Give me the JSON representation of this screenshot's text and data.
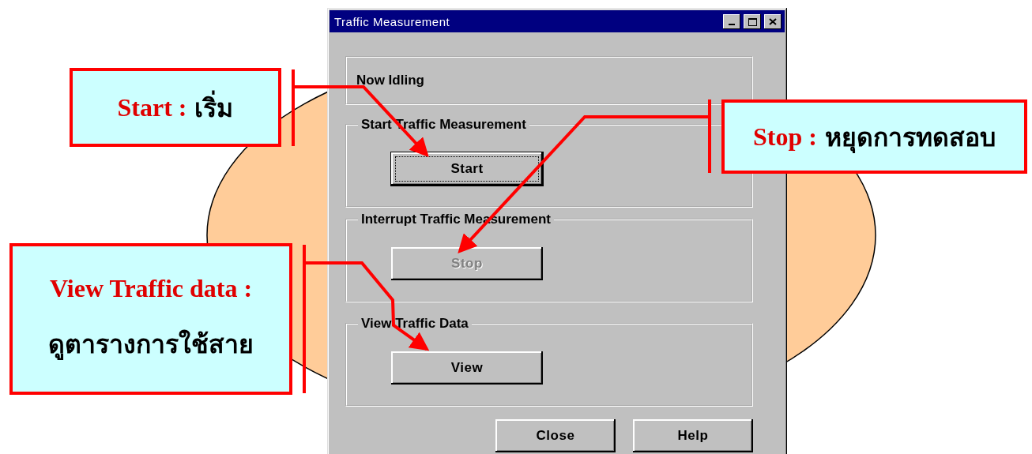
{
  "window": {
    "title": "Traffic Measurement"
  },
  "status": "Now Idling",
  "groups": [
    {
      "title": "Start Traffic Measurement",
      "button": {
        "label": "Start",
        "focused": true,
        "disabled": false
      }
    },
    {
      "title": "Interrupt Traffic Measurement",
      "button": {
        "label": "Stop",
        "focused": false,
        "disabled": true
      }
    },
    {
      "title": "View Traffic Data",
      "button": {
        "label": "View",
        "focused": false,
        "disabled": false
      }
    }
  ],
  "footer_buttons": [
    {
      "label": "Close"
    },
    {
      "label": "Help"
    }
  ],
  "callouts": [
    {
      "kind": "inline",
      "term": "Start :",
      "meaning": "เริ่ม"
    },
    {
      "kind": "inline",
      "term": "Stop :",
      "meaning": "หยุดการทดสอบ"
    },
    {
      "kind": "stacked",
      "term": "View Traffic data :",
      "meaning": "ดูตารางการใช้สาย"
    }
  ]
}
